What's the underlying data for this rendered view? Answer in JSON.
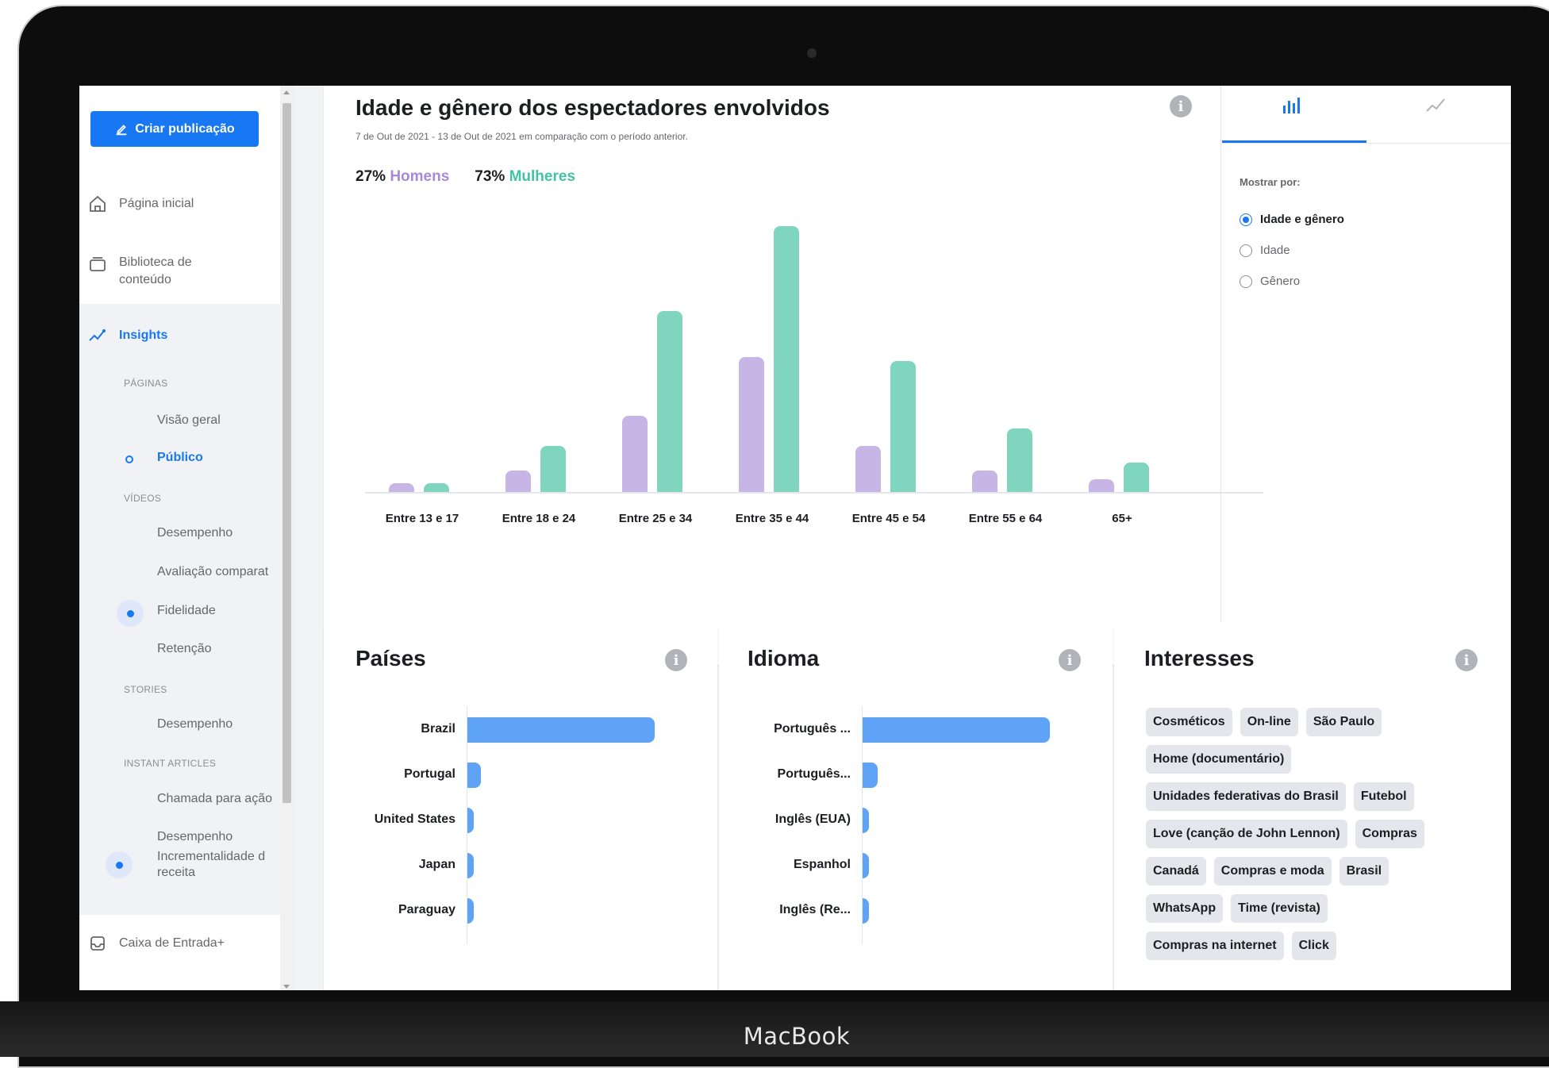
{
  "device_label": "MacBook",
  "sidebar": {
    "create_button": "Criar publicação",
    "items": [
      {
        "label": "Página inicial"
      },
      {
        "label": "Biblioteca de conteúdo"
      },
      {
        "label": "Insights"
      }
    ],
    "sections": {
      "pages": "PÁGINAS",
      "videos": "VÍDEOS",
      "stories": "STORIES",
      "instant_articles": "INSTANT ARTICLES"
    },
    "sub_items": {
      "visao_geral": "Visão geral",
      "publico": "Público",
      "desempenho_videos": "Desempenho",
      "avaliacao": "Avaliação comparat",
      "fidelidade": "Fidelidade",
      "retencao": "Retenção",
      "desempenho_stories": "Desempenho",
      "chamada": "Chamada para ação",
      "desempenho_ia": "Desempenho",
      "incrementalidade": "Incrementalidade d",
      "receita": "receita"
    },
    "inbox": "Caixa de Entrada+"
  },
  "chart_card": {
    "title": "Idade e gênero dos espectadores envolvidos",
    "subtitle": "7 de Out de 2021 - 13 de Out de 2021 em comparação com o período anterior.",
    "men_pct": "27%",
    "men_label": "Homens",
    "women_pct": "73%",
    "women_label": "Mulheres"
  },
  "chart_data": {
    "type": "bar",
    "title": "Idade e gênero dos espectadores envolvidos",
    "categories": [
      "Entre 13 e 17",
      "Entre 18 e 24",
      "Entre 25 e 34",
      "Entre 35 e 44",
      "Entre 45 e 54",
      "Entre 55 e 64",
      "65+"
    ],
    "series": [
      {
        "name": "Homens",
        "color": "#c6b5e5",
        "values": [
          1,
          2.5,
          9,
          16,
          5.5,
          2.5,
          1.5
        ]
      },
      {
        "name": "Mulheres",
        "color": "#7fd5be",
        "values": [
          1,
          5.5,
          21.5,
          31.5,
          15.5,
          7.5,
          3.5
        ]
      }
    ],
    "grid": false,
    "legend": "top-left"
  },
  "display_panel": {
    "show_by_label": "Mostrar por:",
    "options": [
      "Idade e gênero",
      "Idade",
      "Gênero"
    ],
    "selected": "Idade e gênero"
  },
  "countries": {
    "title": "Países",
    "labels": [
      "Brazil",
      "Portugal",
      "United States",
      "Japan",
      "Paraguay"
    ],
    "values": [
      100,
      7,
      3,
      3,
      3
    ]
  },
  "languages": {
    "title": "Idioma",
    "labels": [
      "Português ...",
      "Português...",
      "Inglês (EUA)",
      "Espanhol",
      "Inglês (Re..."
    ],
    "values": [
      100,
      8,
      3,
      3,
      3
    ]
  },
  "interests": {
    "title": "Interesses",
    "chips": [
      "Cosméticos",
      "On-line",
      "São Paulo",
      "Home (documentário)",
      "Unidades federativas do Brasil",
      "Futebol",
      "Love (canção de John Lennon)",
      "Compras",
      "Canadá",
      "Compras e moda",
      "Brasil",
      "WhatsApp",
      "Time (revista)",
      "Compras na internet",
      "Click"
    ]
  },
  "colors": {
    "accent": "#1877f2",
    "men": "#a68ad8",
    "women": "#44c2a4",
    "hbar": "#5fa3f7"
  }
}
